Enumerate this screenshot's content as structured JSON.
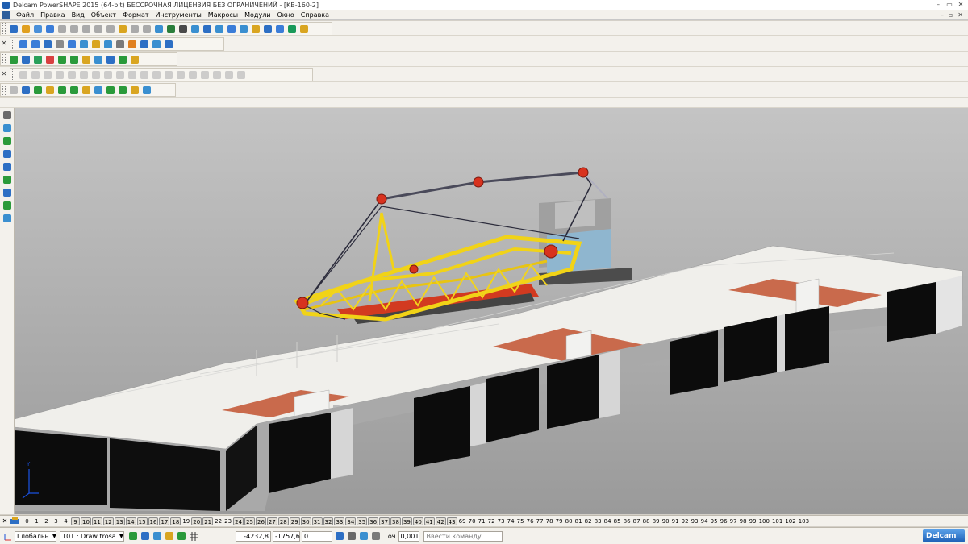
{
  "window": {
    "title": "Delcam PowerSHAPE 2015 (64-bit) БЕССРОЧНАЯ ЛИЦЕНЗИЯ БЕЗ ОГРАНИЧЕНИЙ - [KB-160-2]"
  },
  "menu": {
    "items": [
      "Файл",
      "Правка",
      "Вид",
      "Объект",
      "Формат",
      "Инструменты",
      "Макросы",
      "Модули",
      "Окно",
      "Справка"
    ]
  },
  "toolbars": {
    "row1": [
      "#2d6fc4",
      "#e0a020",
      "#4a90d9",
      "#3b7dd8",
      "#aaaaaa",
      "#aaaaaa",
      "#aaaaaa",
      "#aaaaaa",
      "#aaaaaa",
      "#d9a520",
      "#aaaaaa",
      "#aaaaaa",
      "#3a8fd0",
      "#2a7d3a",
      "#4a4a4a",
      "#3a8fd0",
      "#2d6fc4",
      "#3a8fd0",
      "#3b7dd8",
      "#3a8fd0",
      "#d9a520",
      "#2d6fc4",
      "#3b7dd8",
      "#1a9a5a",
      "#d9a520"
    ],
    "row2": [
      "#3b7dd8",
      "#3b7dd8",
      "#2d6fc4",
      "#8a8a8a",
      "#3b7dd8",
      "#3a8fd0",
      "#d9a520",
      "#3a8fd0",
      "#7a7a7a",
      "#e08020",
      "#2d6fc4",
      "#3a8fd0",
      "#2d6fc4"
    ],
    "row3": [
      "#2a9a3a",
      "#2d6fc4",
      "#2aa05a",
      "#d94040",
      "#2a9a3a",
      "#2a9a3a",
      "#d9a520",
      "#3a8fd0",
      "#2d6fc4",
      "#2a9a3a",
      "#d9a520"
    ],
    "row4": [
      "#bbbbbb",
      "#bbbbbb",
      "#bbbbbb",
      "#bbbbbb",
      "#bbbbbb",
      "#bbbbbb",
      "#bbbbbb",
      "#bbbbbb",
      "#bbbbbb",
      "#bbbbbb",
      "#bbbbbb",
      "#bbbbbb",
      "#bbbbbb",
      "#bbbbbb",
      "#bbbbbb",
      "#bbbbbb",
      "#bbbbbb",
      "#bbbbbb",
      "#bbbbbb"
    ],
    "row5": [
      "#bbbbbb",
      "#2d6fc4",
      "#2a9a3a",
      "#d9a520",
      "#2a9a3a",
      "#2a9a3a",
      "#d9a520",
      "#3a8fd0",
      "#2a9a3a",
      "#2a9a3a",
      "#d9a520",
      "#3a8fd0"
    ]
  },
  "left_tools": [
    "#6a6a6a",
    "#3a8fd0",
    "#2a9a3a",
    "#2d6fc4",
    "#2d6fc4",
    "#2a9a3a",
    "#2d6fc4",
    "#2a9a3a",
    "#3a8fd0"
  ],
  "levels": {
    "items": [
      "0",
      "1",
      "2",
      "3",
      "4",
      "9",
      "10",
      "11",
      "12",
      "13",
      "14",
      "15",
      "16",
      "17",
      "18",
      "19",
      "20",
      "21",
      "22",
      "23",
      "24",
      "25",
      "26",
      "27",
      "28",
      "29",
      "30",
      "31",
      "32",
      "33",
      "34",
      "35",
      "36",
      "37",
      "38",
      "39",
      "40",
      "41",
      "42",
      "43",
      "69",
      "70",
      "71",
      "72",
      "73",
      "74",
      "75",
      "76",
      "77",
      "78",
      "79",
      "80",
      "81",
      "82",
      "83",
      "84",
      "85",
      "86",
      "87",
      "88",
      "89",
      "90",
      "91",
      "92",
      "93",
      "94",
      "95",
      "96",
      "97",
      "98",
      "99",
      "100",
      "101",
      "102",
      "103"
    ],
    "on": [
      "9",
      "10",
      "11",
      "12",
      "13",
      "14",
      "15",
      "16",
      "17",
      "18",
      "20",
      "21",
      "24",
      "25",
      "26",
      "27",
      "28",
      "29",
      "30",
      "31",
      "32",
      "33",
      "34",
      "35",
      "36",
      "37",
      "38",
      "39",
      "40",
      "41",
      "42",
      "43"
    ]
  },
  "status": {
    "workplane": "Глобальн",
    "level": "101 : Draw trosa",
    "x": "-4232,8",
    "y": "-1757,6",
    "z": "0",
    "tol_label": "Точ",
    "tol_value": "0,001",
    "command_placeholder": "Ввести команду",
    "brand": "Delcam"
  },
  "viewport": {
    "axis_label": "Y"
  }
}
